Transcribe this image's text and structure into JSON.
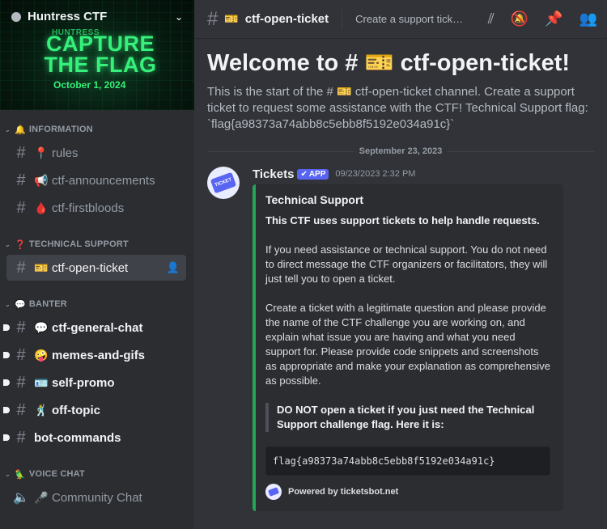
{
  "server": {
    "name": "Huntress CTF",
    "banner_brand": "HUNTRESS",
    "banner_title": "CAPTURE THE FLAG",
    "banner_date": "October 1, 2024"
  },
  "sidebar": {
    "categories": [
      {
        "label": "INFORMATION",
        "emoji": "🔔"
      },
      {
        "label": "TECHNICAL SUPPORT",
        "emoji": "❓"
      },
      {
        "label": "BANTER",
        "emoji": "💬"
      },
      {
        "label": "VOICE CHAT",
        "emoji": "🦜"
      }
    ],
    "channels": [
      {
        "name": "rules",
        "emoji": "📍"
      },
      {
        "name": "ctf-announcements",
        "emoji": "📢"
      },
      {
        "name": "ctf-firstbloods",
        "emoji": "🩸"
      },
      {
        "name": "ctf-open-ticket",
        "emoji": "🎫"
      },
      {
        "name": "ctf-general-chat",
        "emoji": "💬"
      },
      {
        "name": "memes-and-gifs",
        "emoji": "🤪"
      },
      {
        "name": "self-promo",
        "emoji": "🪪"
      },
      {
        "name": "off-topic",
        "emoji": "🕺"
      },
      {
        "name": "bot-commands",
        "emoji": ""
      },
      {
        "name": "Community Chat",
        "emoji": "🎤"
      }
    ]
  },
  "topbar": {
    "channel_emoji": "🎫",
    "channel_name": "ctf-open-ticket",
    "topic": "Create a support ticket to request some assistance with the CTF!"
  },
  "welcome": {
    "heading": "Welcome to # 🎫 ctf-open-ticket!",
    "description": "This is the start of the # 🎫 ctf-open-ticket channel. Create a support ticket to request some assistance with the CTF! Technical Support flag: `flag{a98373a74abb8c5ebb8f5192e034a91c}`"
  },
  "date_divider": "September 23, 2023",
  "message": {
    "author": "Tickets",
    "tag": "APP",
    "timestamp": "09/23/2023 2:32 PM",
    "embed": {
      "title": "Technical Support",
      "bold_line": "This CTF uses support tickets to help handle requests.",
      "para1": "If you need assistance or technical support. You do not need to direct message the CTF organizers or facilitators, they will just tell you to open a ticket.",
      "para2": "Create a ticket with a legitimate question and please provide the name of the CTF challenge you are working on, and explain what issue you are having and what you need support for. Please provide code snippets and screenshots as appropriate and make your explanation as comprehensive as possible.",
      "quote": "DO NOT open a ticket if you just need the Technical Support challenge flag. Here it is:",
      "code": "flag{a98373a74abb8c5ebb8f5192e034a91c}",
      "footer": "Powered by ticketsbot.net"
    }
  },
  "colors": {
    "accent": "#5865f2",
    "embed_border": "#23a55a"
  }
}
